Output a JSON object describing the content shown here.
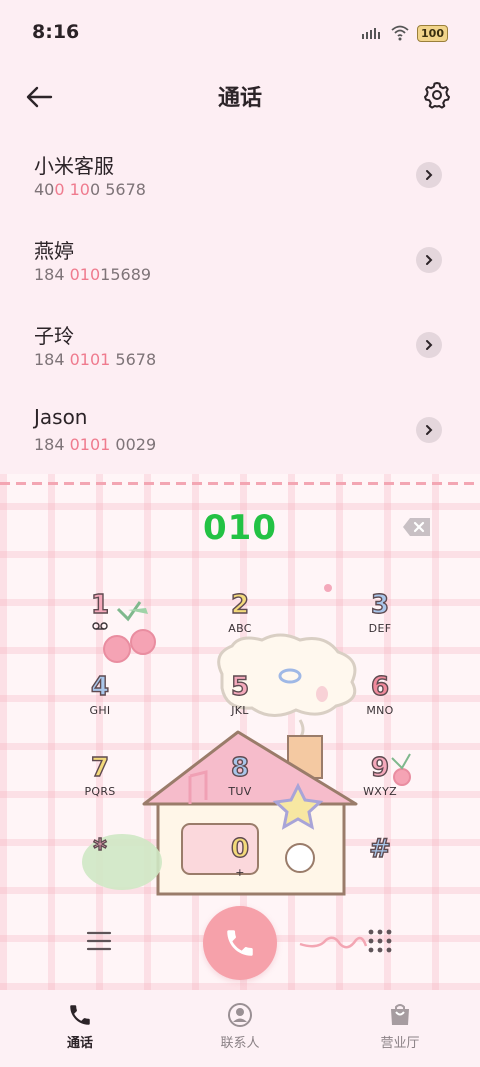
{
  "status_bar": {
    "time": "8:16",
    "battery": "100"
  },
  "header": {
    "title": "通话"
  },
  "contacts": [
    {
      "name": "小米客服",
      "number_parts": [
        "40",
        "0 10",
        "0 5678"
      ]
    },
    {
      "name": "燕婷",
      "number_parts": [
        "184 ",
        "010",
        "15689"
      ]
    },
    {
      "name": "子玲",
      "number_parts": [
        "184 ",
        "0101",
        " 5678"
      ]
    },
    {
      "name": "Jason",
      "number_parts": [
        "184 ",
        "0101",
        " 0029"
      ]
    }
  ],
  "dialer": {
    "dialed_number": "010",
    "keys": [
      {
        "digit": "1",
        "letters": ""
      },
      {
        "digit": "2",
        "letters": "ABC"
      },
      {
        "digit": "3",
        "letters": "DEF"
      },
      {
        "digit": "4",
        "letters": "GHI"
      },
      {
        "digit": "5",
        "letters": "JKL"
      },
      {
        "digit": "6",
        "letters": "MNO"
      },
      {
        "digit": "7",
        "letters": "PQRS"
      },
      {
        "digit": "8",
        "letters": "TUV"
      },
      {
        "digit": "9",
        "letters": "WXYZ"
      },
      {
        "digit": "*",
        "letters": ""
      },
      {
        "digit": "0",
        "letters": "+"
      },
      {
        "digit": "#",
        "letters": ""
      }
    ]
  },
  "bottom_nav": [
    {
      "label": "通话",
      "icon": "phone-icon",
      "active": true
    },
    {
      "label": "联系人",
      "icon": "contacts-icon",
      "active": false
    },
    {
      "label": "营业厅",
      "icon": "shopping-bag-icon",
      "active": false
    }
  ],
  "colors": {
    "accent_pink": "#ef7b8e",
    "dialed_green": "#23c244",
    "call_button": "#f6a1aa",
    "background": "#fdeef3"
  }
}
